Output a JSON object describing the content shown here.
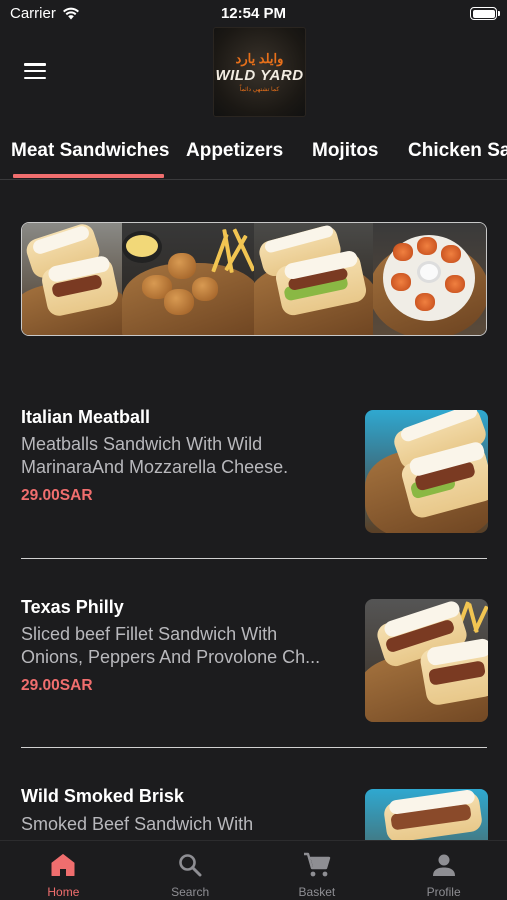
{
  "status_bar": {
    "carrier": "Carrier",
    "time": "12:54 PM"
  },
  "header": {
    "menu_icon": "hamburger-icon",
    "logo": {
      "arabic": "وايلد يارد",
      "english": "WILD YARD",
      "tagline": "كما تشتهي دائماً"
    }
  },
  "tabs": [
    {
      "label": "Meat Sandwiches",
      "active": true
    },
    {
      "label": "Appetizers",
      "active": false
    },
    {
      "label": "Mojitos",
      "active": false
    },
    {
      "label": "Chicken Sa",
      "active": false
    }
  ],
  "menu_items": [
    {
      "title": "Italian Meatball",
      "desc_line1": "Meatballs Sandwich With Wild",
      "desc_line2": "MarinaraAnd Mozzarella Cheese.",
      "price": "29.00SAR"
    },
    {
      "title": "Texas Philly",
      "desc_line1": "Sliced beef Fillet Sandwich With",
      "desc_line2": "Onions, Peppers And Provolone Ch...",
      "price": "29.00SAR"
    },
    {
      "title": "Wild Smoked Brisk",
      "desc_line1": "Smoked Beef Sandwich With",
      "desc_line2": "",
      "price": ""
    }
  ],
  "tabbar": [
    {
      "label": "Home",
      "icon": "home-icon",
      "active": true
    },
    {
      "label": "Search",
      "icon": "search-icon",
      "active": false
    },
    {
      "label": "Basket",
      "icon": "cart-icon",
      "active": false
    },
    {
      "label": "Profile",
      "icon": "person-icon",
      "active": false
    }
  ],
  "colors": {
    "accent": "#f06e6e",
    "background": "#1c1c1e",
    "inactive": "#8e8e93"
  }
}
